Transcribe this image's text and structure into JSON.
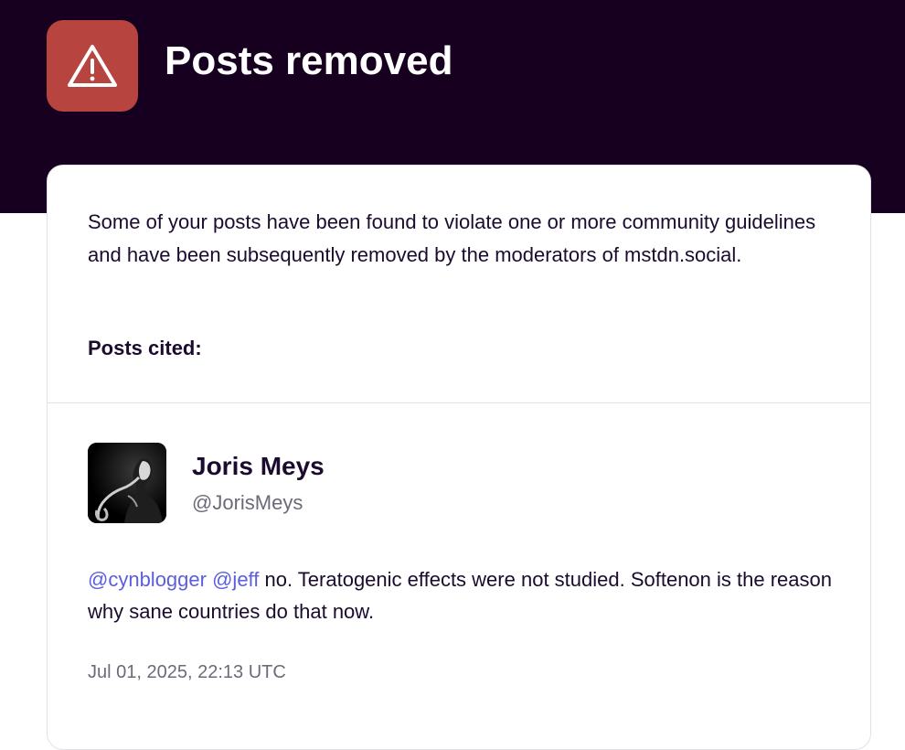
{
  "header": {
    "title": "Posts removed",
    "icon": "warning-triangle-icon",
    "band_color": "#17001f",
    "icon_tile_color": "#b84440"
  },
  "notice": {
    "message": "Some of your posts have been found to violate one or more community guidelines and have been subsequently removed by the moderators of mstdn.social.",
    "cited_label": "Posts cited:"
  },
  "post": {
    "author": {
      "display_name": "Joris Meys",
      "handle": "@JorisMeys",
      "avatar": "avatar-photo"
    },
    "mentions": [
      "@cynblogger",
      "@jeff"
    ],
    "text": " no. Teratogenic effects were not studied. Softenon is the reason why sane countries do that now.",
    "timestamp": "Jul 01, 2025, 22:13 UTC",
    "mention_color": "#5b5ee0"
  }
}
